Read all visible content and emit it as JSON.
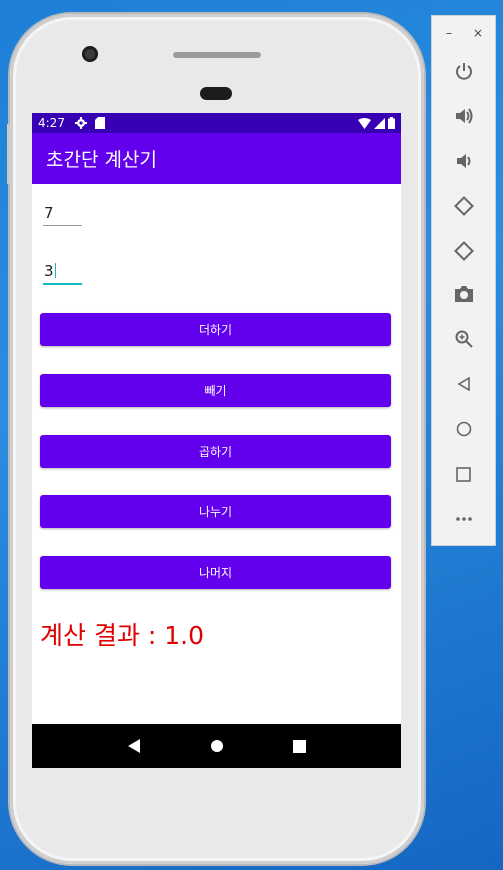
{
  "status_bar": {
    "time": "4:27"
  },
  "app": {
    "title": "초간단 계산기"
  },
  "inputs": {
    "first_value": "7",
    "second_value": "3"
  },
  "buttons": {
    "add": "더하기",
    "subtract": "빼기",
    "multiply": "곱하기",
    "divide": "나누기",
    "remainder": "나머지"
  },
  "result": {
    "text": "계산 결과 : 1.0"
  },
  "emulator_panel": {
    "window_controls": {
      "minimize": "–",
      "close": "×"
    },
    "tools": [
      "power-icon",
      "volume-up-icon",
      "volume-down-icon",
      "rotate-left-icon",
      "rotate-right-icon",
      "camera-icon",
      "zoom-icon",
      "back-icon",
      "home-icon",
      "overview-icon",
      "more-icon"
    ]
  },
  "colors": {
    "primary": "#6200ee",
    "primary_dark": "#3700b3",
    "result_text": "#e00000",
    "focus_accent": "#18b8c0"
  }
}
